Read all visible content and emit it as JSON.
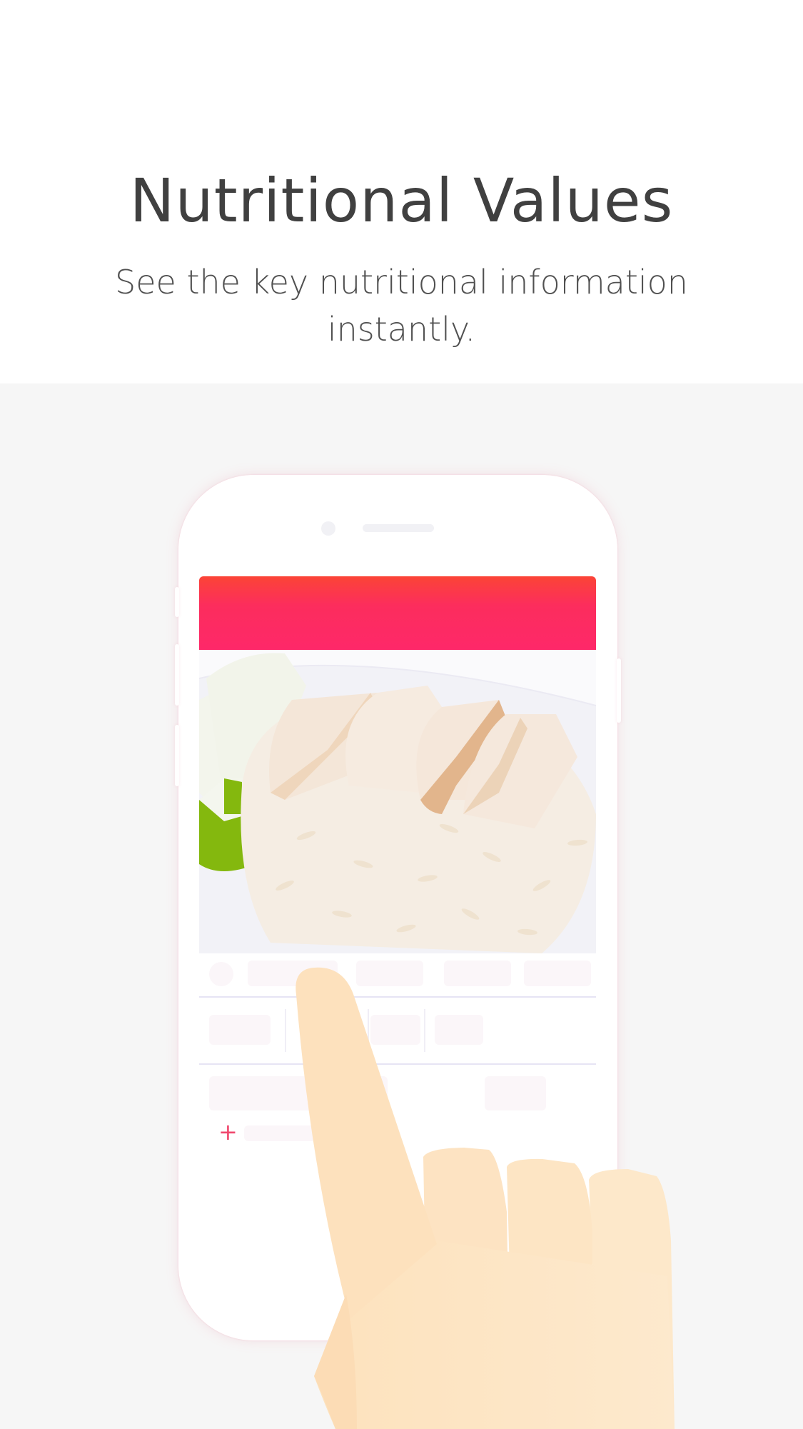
{
  "hero": {
    "title": "Nutritional Values",
    "subtitle": "See the key nutritional information instantly."
  },
  "colors": {
    "stage_background": "#f6f6f6",
    "header_gradient_top": "#fb4436",
    "header_gradient_bottom": "#fe2869",
    "accent": "#f0486e",
    "title_text": "#404040"
  },
  "icons": {
    "add": "+"
  }
}
